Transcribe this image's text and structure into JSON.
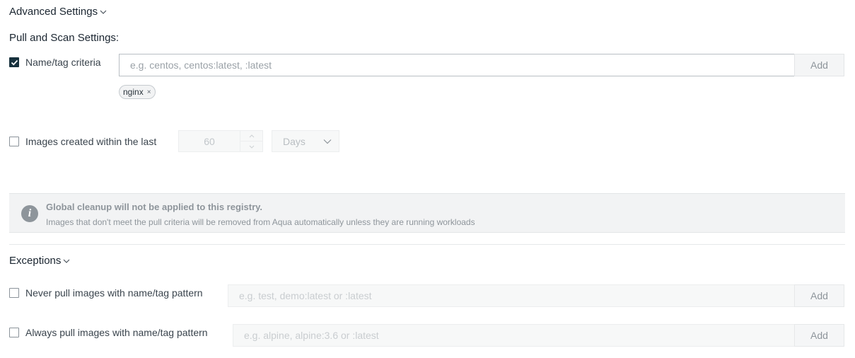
{
  "advanced_settings": {
    "title": "Advanced Settings",
    "expand_icon": "chevron-down-icon"
  },
  "pull_scan": {
    "heading": "Pull and Scan Settings:",
    "name_tag": {
      "checked": true,
      "label": "Name/tag criteria",
      "placeholder": "e.g. centos, centos:latest, :latest",
      "add_label": "Add",
      "tags": [
        {
          "label": "nginx",
          "remove_glyph": "×"
        }
      ]
    },
    "images_created": {
      "checked": false,
      "label": "Images created within the last",
      "value": "60",
      "unit": "Days"
    }
  },
  "info": {
    "icon": "info-icon",
    "icon_glyph": "i",
    "title": "Global cleanup will not be applied to this registry.",
    "text": "Images that don't meet the pull criteria will be removed from Aqua automatically unless they are running workloads"
  },
  "exceptions": {
    "title": "Exceptions",
    "expand_icon": "chevron-down-icon",
    "never_pull": {
      "checked": false,
      "label": "Never pull images with name/tag pattern",
      "placeholder": "e.g. test, demo:latest or :latest",
      "add_label": "Add"
    },
    "always_pull": {
      "checked": false,
      "label": "Always pull images with name/tag pattern",
      "placeholder": "e.g. alpine, alpine:3.6 or :latest",
      "add_label": "Add"
    }
  },
  "colors": {
    "checkbox_checked": "#17313d",
    "info_background": "#f2f3f4",
    "muted_text": "#8e959b"
  }
}
